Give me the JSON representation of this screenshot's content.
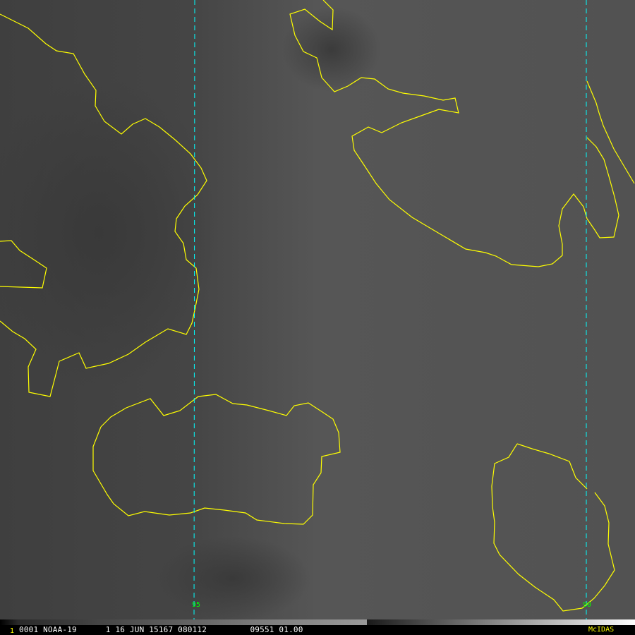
{
  "meridians": [
    {
      "label": "95"
    },
    {
      "label": "90"
    }
  ],
  "status": {
    "frame": "1",
    "text": "0001 NOAA-19      1 16 JUN 15167 080112         09551 01.00",
    "brand": "McIDAS"
  },
  "colors": {
    "coastline": "#ffff00",
    "gridline": "#00ffff",
    "grid_label": "#00ff00",
    "status_text": "#ffffff",
    "frame_number": "#ffff00"
  }
}
